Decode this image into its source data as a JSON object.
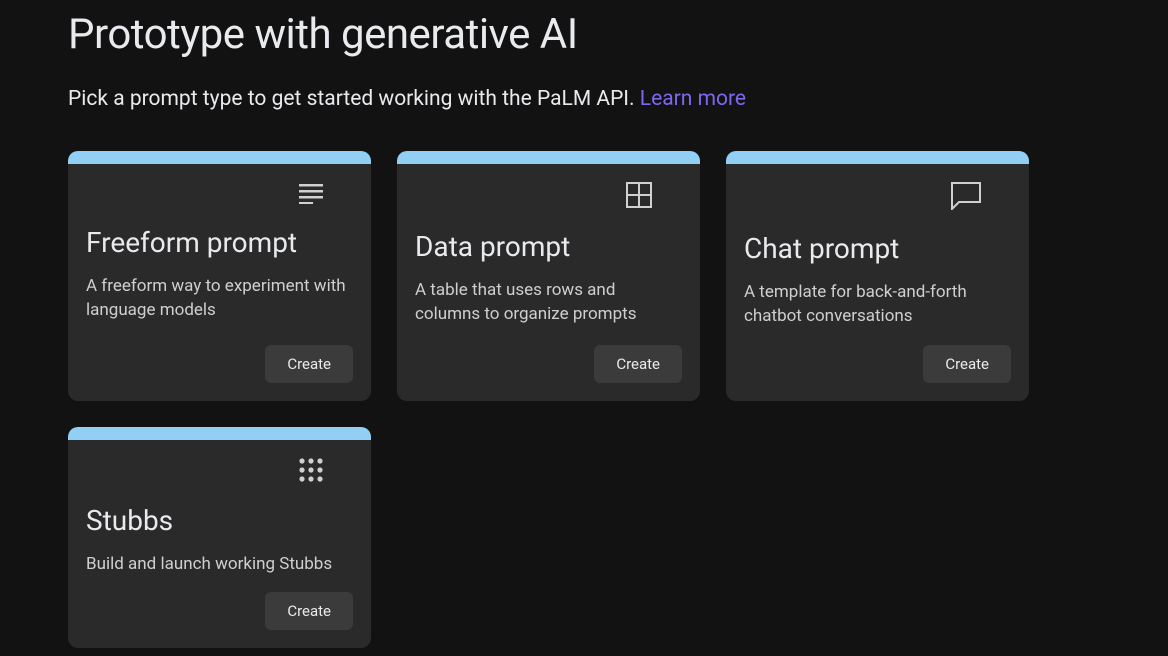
{
  "header": {
    "title": "Prototype with generative AI",
    "subtitle": "Pick a prompt type to get started working with the PaLM API. ",
    "learn_more": "Learn more"
  },
  "cards": [
    {
      "icon": "text-lines-icon",
      "title": "Freeform prompt",
      "description": "A freeform way to experiment with language models",
      "button": "Create"
    },
    {
      "icon": "grid-icon",
      "title": "Data prompt",
      "description": "A table that uses rows and columns to organize prompts",
      "button": "Create"
    },
    {
      "icon": "chat-icon",
      "title": "Chat prompt",
      "description": "A template for back-and-forth chatbot conversations",
      "button": "Create"
    },
    {
      "icon": "apps-icon",
      "title": "Stubbs",
      "description": "Build and launch working Stubbs",
      "button": "Create"
    }
  ]
}
